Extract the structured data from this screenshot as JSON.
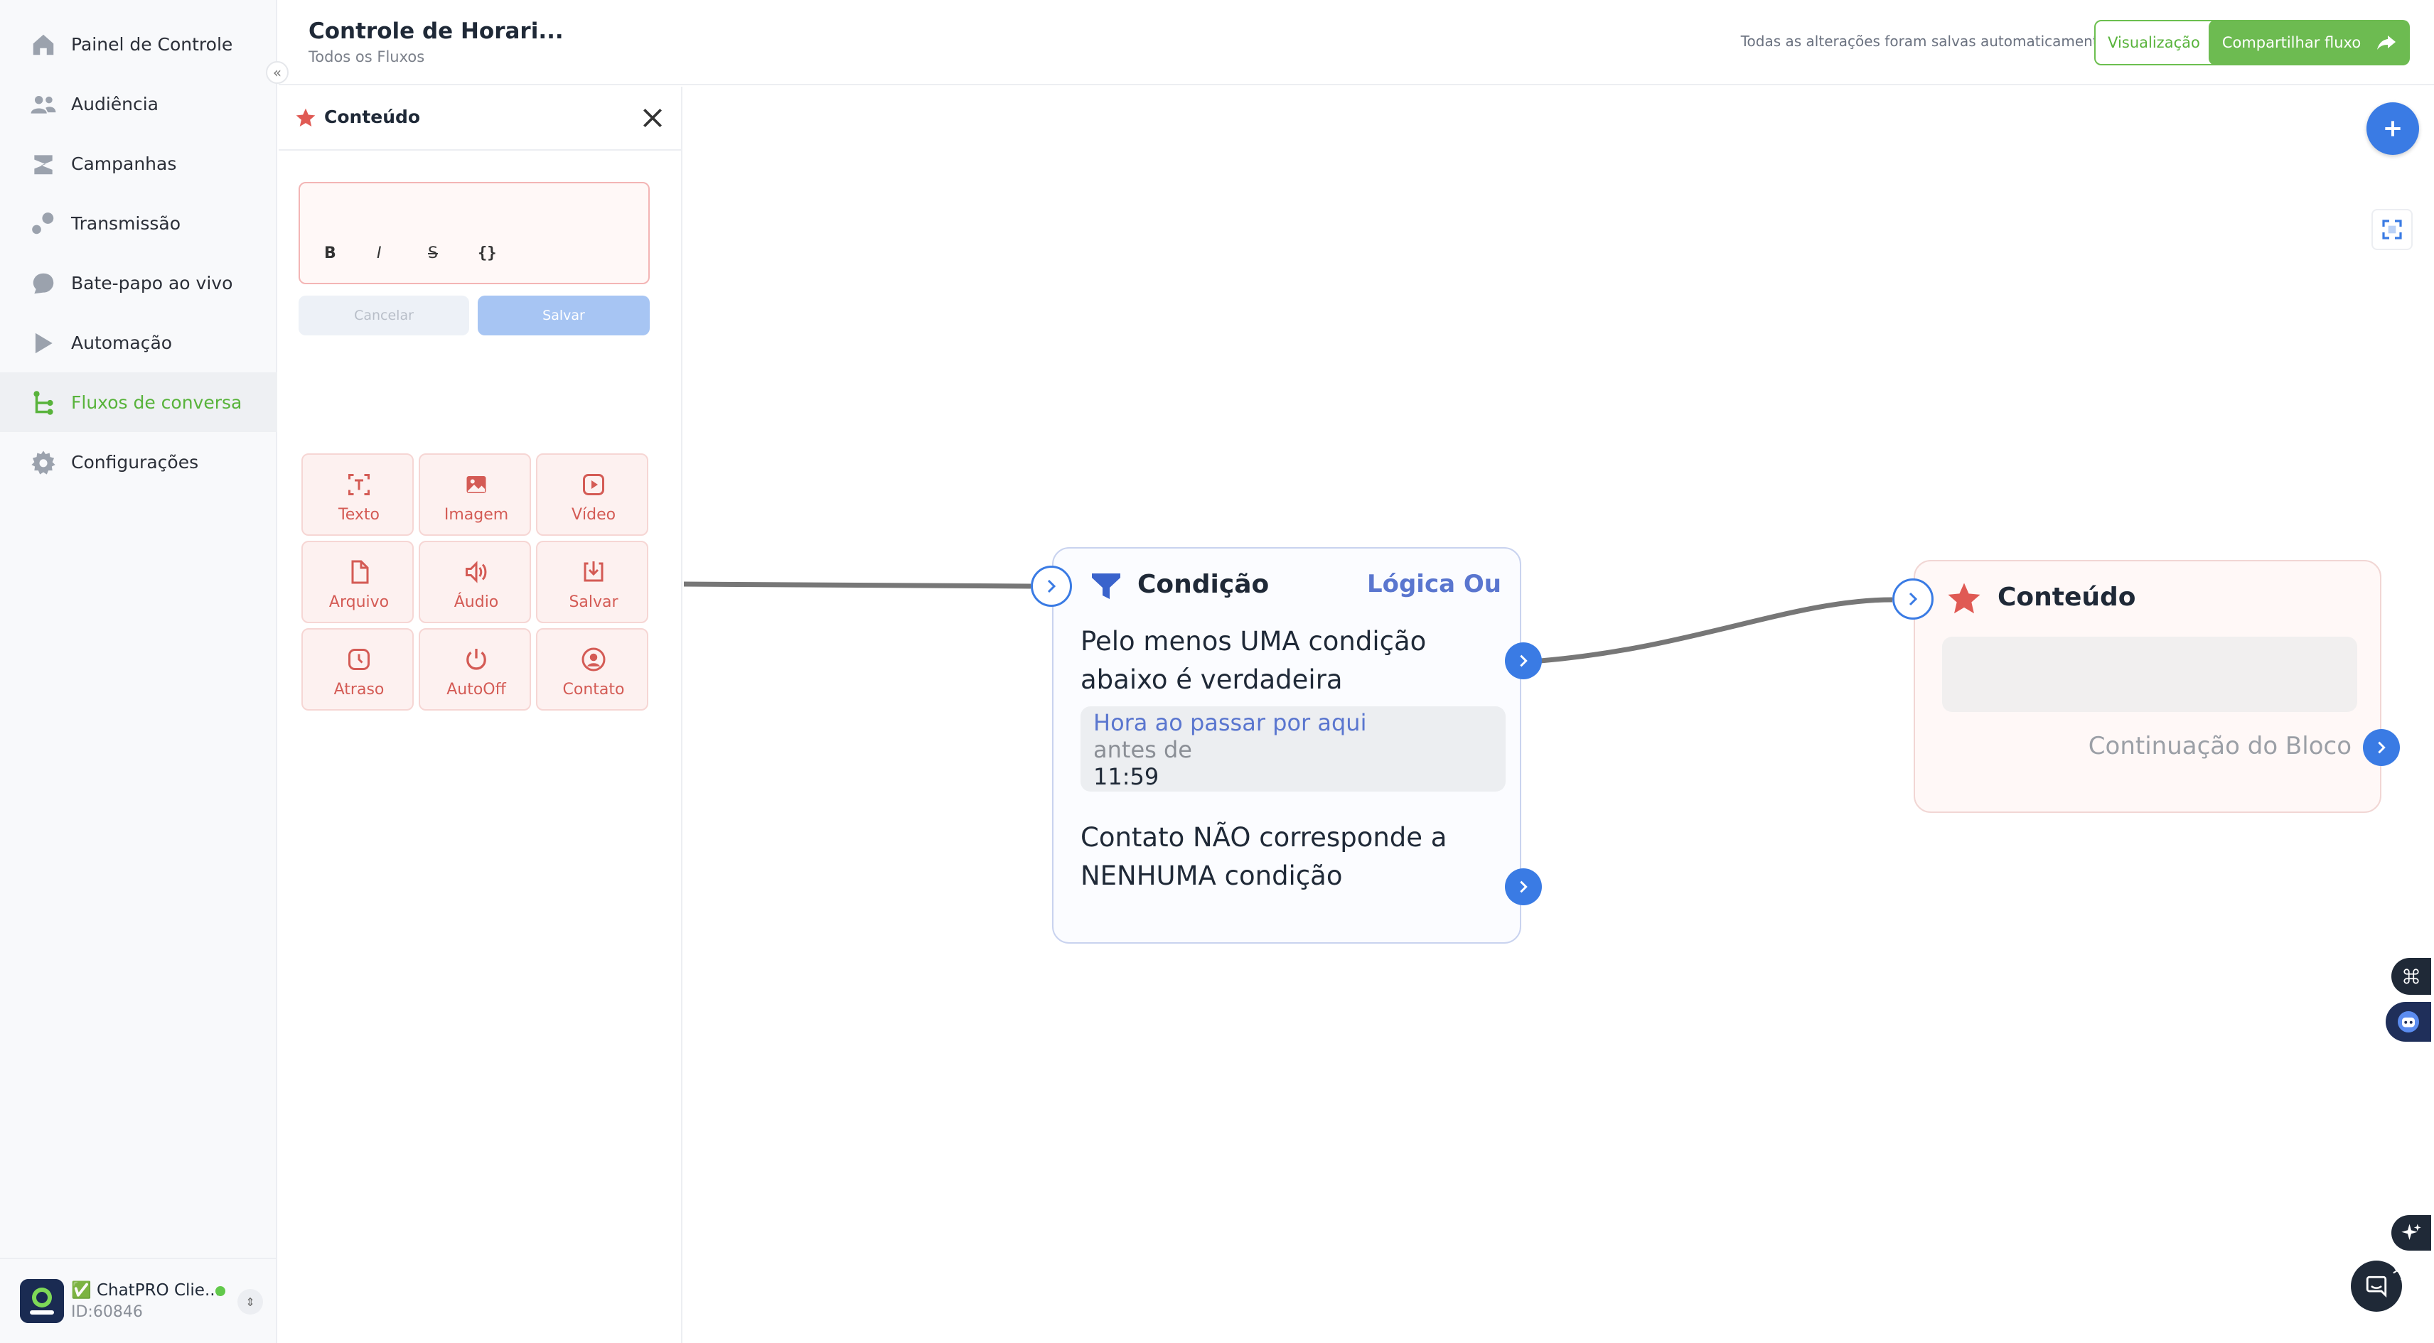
{
  "sidebar": {
    "items": [
      {
        "label": "Painel de Controle",
        "icon": "home-icon"
      },
      {
        "label": "Audiência",
        "icon": "people-icon"
      },
      {
        "label": "Campanhas",
        "icon": "campaign-icon"
      },
      {
        "label": "Transmissão",
        "icon": "broadcast-icon"
      },
      {
        "label": "Bate-papo ao vivo",
        "icon": "chat-icon"
      },
      {
        "label": "Automação",
        "icon": "automation-icon"
      },
      {
        "label": "Fluxos de conversa",
        "icon": "flow-icon",
        "active": true
      },
      {
        "label": "Configurações",
        "icon": "gear-icon"
      }
    ],
    "account": {
      "name": "✅ ChatPRO Clie...",
      "id": "ID:60846"
    }
  },
  "header": {
    "title": "Controle de Horari...",
    "breadcrumb": "Todos os Fluxos",
    "saved_status": "Todas as alterações foram salvas automaticamente",
    "preview_label": "Visualização",
    "share_label": "Compartilhar fluxo"
  },
  "panel": {
    "title": "Conteúdo",
    "format_buttons": [
      "B",
      "I",
      "S",
      "{}"
    ],
    "cancel_label": "Cancelar",
    "save_label": "Salvar",
    "tiles": [
      {
        "label": "Texto",
        "icon": "text-icon"
      },
      {
        "label": "Imagem",
        "icon": "image-icon"
      },
      {
        "label": "Vídeo",
        "icon": "video-icon"
      },
      {
        "label": "Arquivo",
        "icon": "file-icon"
      },
      {
        "label": "Áudio",
        "icon": "audio-icon"
      },
      {
        "label": "Salvar",
        "icon": "download-icon"
      },
      {
        "label": "Atraso",
        "icon": "clock-icon"
      },
      {
        "label": "AutoOff",
        "icon": "power-icon"
      },
      {
        "label": "Contato",
        "icon": "contact-icon"
      }
    ]
  },
  "canvas": {
    "condition_node": {
      "title": "Condição",
      "logic": "Lógica Ou",
      "match_text": "Pelo menos UMA condição abaixo é verdadeira",
      "condition_field": "Hora ao passar por aqui",
      "condition_operator": "antes de",
      "condition_value": "11:59",
      "fallback_text": "Contato NÃO corresponde a NENHUMA condição"
    },
    "content_node": {
      "title": "Conteúdo",
      "continuation": "Continuação do Bloco"
    }
  },
  "colors": {
    "brand_green": "#6dbb51",
    "accent_blue": "#3a7be4",
    "content_red": "#d45b55",
    "logic_blue": "#5a76cf"
  }
}
